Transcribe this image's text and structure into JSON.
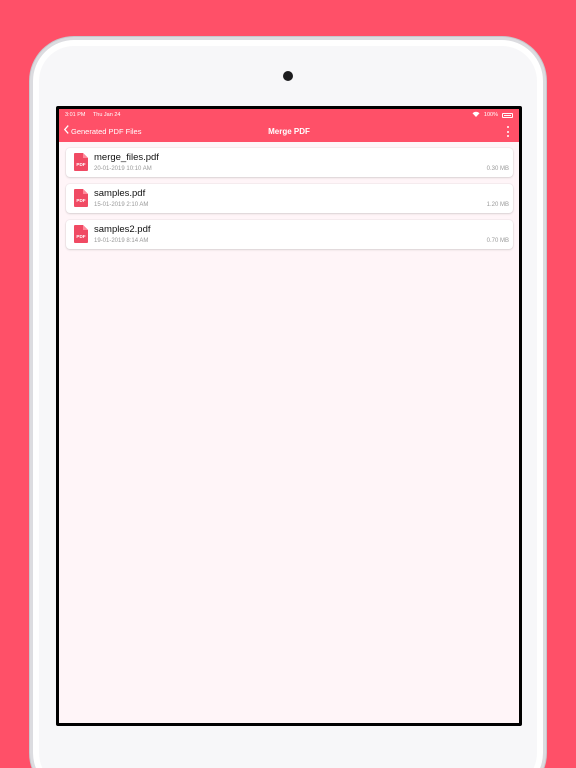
{
  "colors": {
    "accent": "#FF5068",
    "screen_bg": "#FFF5F8",
    "pdf_icon": "#F04A63"
  },
  "statusbar": {
    "time": "3:01 PM",
    "date": "Thu Jan 24",
    "battery": "100%"
  },
  "navbar": {
    "back_label": "Generated PDF Files",
    "title": "Merge PDF",
    "more_icon": "more-vertical-icon"
  },
  "files": [
    {
      "name": "merge_files.pdf",
      "date": "20-01-2019 10:10 AM",
      "size": "0.30 MB",
      "icon": "pdf-file-icon",
      "icon_text": "PDF"
    },
    {
      "name": "samples.pdf",
      "date": "15-01-2019 2:10 AM",
      "size": "1.20 MB",
      "icon": "pdf-file-icon",
      "icon_text": "PDF"
    },
    {
      "name": "samples2.pdf",
      "date": "19-01-2019 8:14 AM",
      "size": "0.70 MB",
      "icon": "pdf-file-icon",
      "icon_text": "PDF"
    }
  ]
}
